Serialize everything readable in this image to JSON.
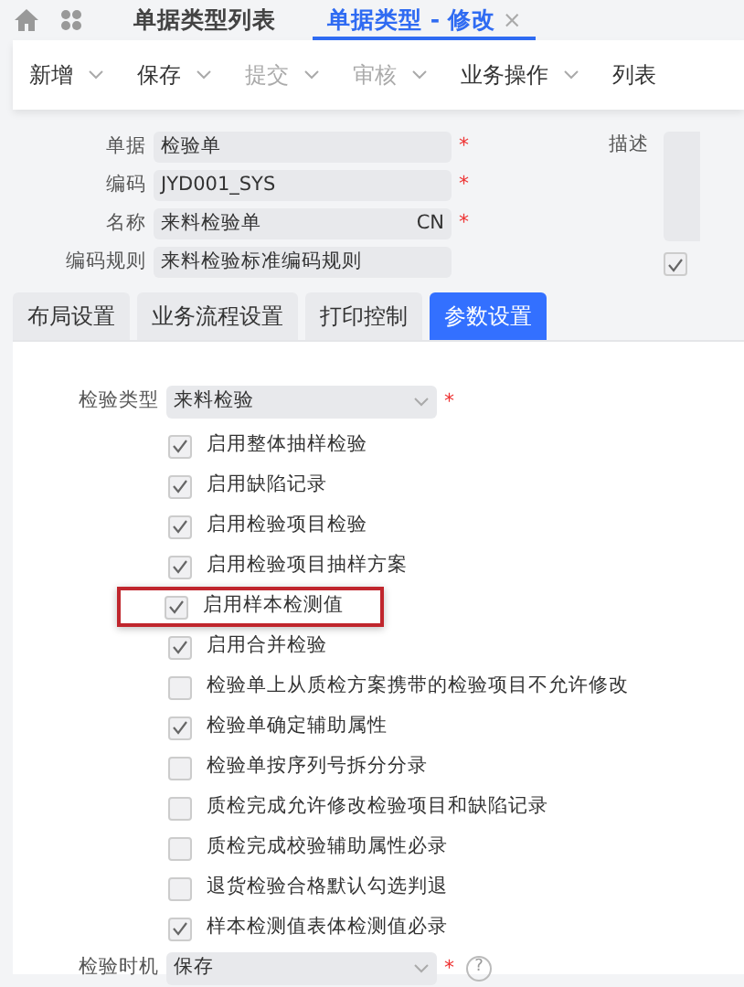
{
  "top_tabs": [
    {
      "label": "单据类型列表",
      "selected": false
    },
    {
      "label": "单据类型 - 修改",
      "selected": true,
      "close": "×"
    }
  ],
  "toolbar": [
    {
      "label": "新增",
      "disabled": false,
      "dropdown": true
    },
    {
      "label": "保存",
      "disabled": false,
      "dropdown": true
    },
    {
      "label": "提交",
      "disabled": true,
      "dropdown": true
    },
    {
      "label": "审核",
      "disabled": true,
      "dropdown": true
    },
    {
      "label": "业务操作",
      "disabled": false,
      "dropdown": true
    },
    {
      "label": "列表",
      "disabled": false,
      "dropdown": false
    }
  ],
  "form": [
    {
      "label": "单据",
      "value": "检验单",
      "required": "*"
    },
    {
      "label": "编码",
      "value": "JYD001_SYS",
      "required": "*"
    },
    {
      "label": "名称",
      "value": "来料检验单",
      "suffix": "CN",
      "required": "*"
    },
    {
      "label": "编码规则",
      "value": "来料检验标准编码规则"
    }
  ],
  "description": {
    "label": "描述"
  },
  "side_checkbox": {
    "checked": true
  },
  "section_tabs": [
    {
      "label": "布局设置",
      "selected": false
    },
    {
      "label": "业务流程设置",
      "selected": false
    },
    {
      "label": "打印控制",
      "selected": false
    },
    {
      "label": "参数设置",
      "selected": true
    }
  ],
  "inspection_type": {
    "label": "检验类型",
    "value": "来料检验",
    "required": "*"
  },
  "options": [
    {
      "label": "启用整体抽样检验",
      "checked": true,
      "highlighted": false
    },
    {
      "label": "启用缺陷记录",
      "checked": true,
      "highlighted": false
    },
    {
      "label": "启用检验项目检验",
      "checked": true,
      "highlighted": false
    },
    {
      "label": "启用检验项目抽样方案",
      "checked": true,
      "highlighted": false
    },
    {
      "label": "启用样本检测值",
      "checked": true,
      "highlighted": true
    },
    {
      "label": "启用合并检验",
      "checked": true,
      "highlighted": false
    },
    {
      "label": "检验单上从质检方案携带的检验项目不允许修改",
      "checked": false,
      "highlighted": false
    },
    {
      "label": "检验单确定辅助属性",
      "checked": true,
      "highlighted": false
    },
    {
      "label": "检验单按序列号拆分分录",
      "checked": false,
      "highlighted": false
    },
    {
      "label": "质检完成允许修改检验项目和缺陷记录",
      "checked": false,
      "highlighted": false
    },
    {
      "label": "质检完成校验辅助属性必录",
      "checked": false,
      "highlighted": false
    },
    {
      "label": "退货检验合格默认勾选判退",
      "checked": false,
      "highlighted": false
    },
    {
      "label": "样本检测值表体检测值必录",
      "checked": true,
      "highlighted": false
    }
  ],
  "inspection_timing": {
    "label": "检验时机",
    "value": "保存",
    "required": "*",
    "help": "?"
  }
}
